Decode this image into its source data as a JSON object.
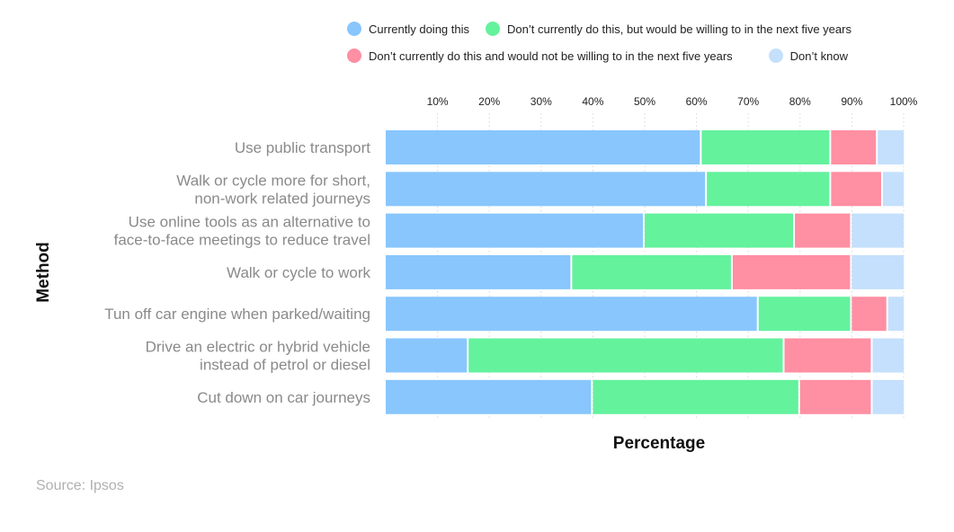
{
  "chart_data": {
    "type": "bar",
    "orientation": "horizontal",
    "stacked": true,
    "title": "",
    "xlabel": "Percentage",
    "ylabel": "Method",
    "xlim": [
      0,
      100
    ],
    "x_ticks": [
      "10%",
      "20%",
      "30%",
      "40%",
      "50%",
      "60%",
      "70%",
      "80%",
      "90%",
      "100%"
    ],
    "x_tick_values": [
      10,
      20,
      30,
      40,
      50,
      60,
      70,
      80,
      90,
      100
    ],
    "grid": "vertical dotted",
    "legend_position": "top-right",
    "categories": [
      [
        "Use public transport"
      ],
      [
        "Walk or cycle more for short,",
        "non-work related journeys"
      ],
      [
        "Use online tools as an alternative to",
        "face-to-face meetings to reduce travel"
      ],
      [
        "Walk or cycle to work"
      ],
      [
        "Tun off car engine when parked/waiting"
      ],
      [
        "Drive an electric or hybrid vehicle",
        "instead of petrol or diesel"
      ],
      [
        "Cut down on car journeys"
      ]
    ],
    "series": [
      {
        "name": "Currently doing this",
        "color": "#88c6fd",
        "values": [
          61,
          62,
          50,
          36,
          72,
          16,
          40
        ]
      },
      {
        "name": "Don’t currently do this, but would be willing to in the next five years",
        "color": "#64f29d",
        "values": [
          25,
          24,
          29,
          31,
          18,
          61,
          40
        ]
      },
      {
        "name": "Don’t currently do this and would not be willing to in the next five years",
        "color": "#ff8fa3",
        "values": [
          9,
          10,
          11,
          23,
          7,
          17,
          14
        ]
      },
      {
        "name": "Don’t know",
        "color": "#c4e0fc",
        "values": [
          5,
          4,
          10,
          10,
          3,
          6,
          6
        ]
      }
    ]
  },
  "footer": {
    "source": "Source: Ipsos"
  }
}
